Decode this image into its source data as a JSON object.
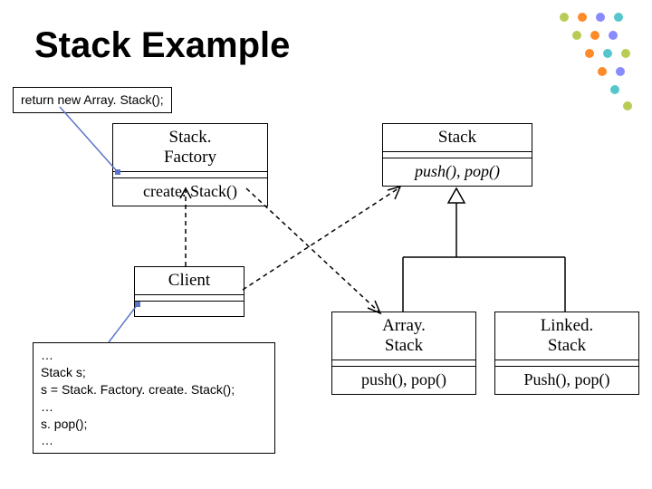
{
  "title": "Stack Example",
  "diagram": {
    "notes": {
      "factory_note": "return new Array. Stack();",
      "client_note_lines": [
        "…",
        "Stack s;",
        "s = Stack. Factory. create. Stack();",
        "…",
        "s. pop();",
        "…"
      ]
    },
    "classes": {
      "factory": {
        "name": "Stack. Factory",
        "ops": "create. Stack()"
      },
      "stack": {
        "name": "Stack",
        "ops": "push(), pop()",
        "ops_italic": true
      },
      "client": {
        "name": "Client",
        "ops": ""
      },
      "array": {
        "name": "Array. Stack",
        "ops": "push(), pop()"
      },
      "linked": {
        "name": "Linked. Stack",
        "ops": "Push(), pop()"
      }
    },
    "relations": [
      {
        "from": "factory_note",
        "to": "factory.createStack",
        "style": "note-link"
      },
      {
        "from": "client_note",
        "to": "client",
        "style": "note-link"
      },
      {
        "from": "client",
        "to": "factory",
        "style": "dependency"
      },
      {
        "from": "client",
        "to": "stack",
        "style": "dependency"
      },
      {
        "from": "factory",
        "to": "array",
        "style": "dependency"
      },
      {
        "from": "array",
        "to": "stack",
        "style": "generalization"
      },
      {
        "from": "linked",
        "to": "stack",
        "style": "generalization"
      }
    ]
  }
}
